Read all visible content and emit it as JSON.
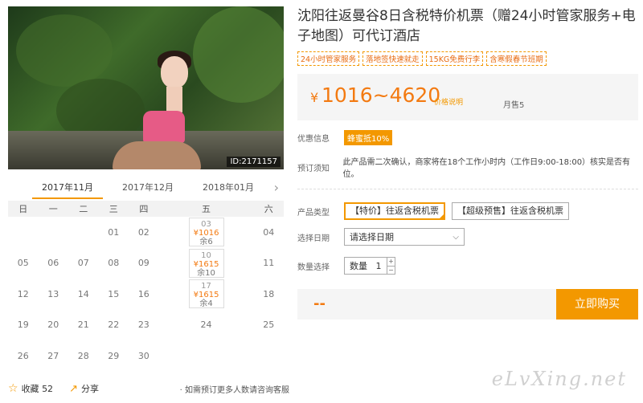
{
  "photo": {
    "id_badge": "ID:2171157"
  },
  "calendar": {
    "months": [
      "2017年11月",
      "2017年12月",
      "2018年01月"
    ],
    "weekdays": [
      "日",
      "一",
      "二",
      "三",
      "四",
      "五",
      "六"
    ],
    "rows": [
      [
        "",
        "",
        "",
        "01",
        "02",
        {
          "d": "03",
          "p": "¥1016",
          "r": "余6"
        },
        "04"
      ],
      [
        "05",
        "06",
        "07",
        "08",
        "09",
        {
          "d": "10",
          "p": "¥1615",
          "r": "余10"
        },
        "11"
      ],
      [
        "12",
        "13",
        "14",
        "15",
        "16",
        {
          "d": "17",
          "p": "¥1615",
          "r": "余4"
        },
        "18"
      ],
      [
        "19",
        "20",
        "21",
        "22",
        "23",
        "24",
        "25"
      ],
      [
        "26",
        "27",
        "28",
        "29",
        "30",
        "",
        ""
      ]
    ]
  },
  "footer": {
    "favorite_label": "收藏",
    "favorite_count": "52",
    "share_label": "分享",
    "tip": "· 如需预订更多人数请咨询客服"
  },
  "product": {
    "title": "沈阳往返曼谷8日含税特价机票（赠24小时管家服务+电子地图）可代订酒店",
    "tags": [
      "24小时管家服务",
      "落地签快速就走",
      "15KG免费行李",
      "含寒假春节班期"
    ],
    "price_symbol": "¥",
    "price_range": "1016~4620",
    "price_note": "价格说明",
    "sold": "月售5",
    "promo_label": "优惠信息",
    "promo_badge": "蜂蜜抵10%",
    "notice_label": "预订须知",
    "notice_text": "此产品需二次确认，商家将在18个工作小时内（工作日9:00-18:00）核实是否有位。",
    "type_label": "产品类型",
    "types": [
      "【特价】往返含税机票",
      "【超级预售】往返含税机票"
    ],
    "date_label": "选择日期",
    "date_placeholder": "请选择日期",
    "qty_label": "数量选择",
    "qty_inner_label": "数量",
    "qty_value": "1",
    "placeholder_price": "--",
    "buy_label": "立即购买"
  },
  "watermark": "eLvXing.net",
  "colors": {
    "accent": "#f39800",
    "price": "#f37a11"
  }
}
